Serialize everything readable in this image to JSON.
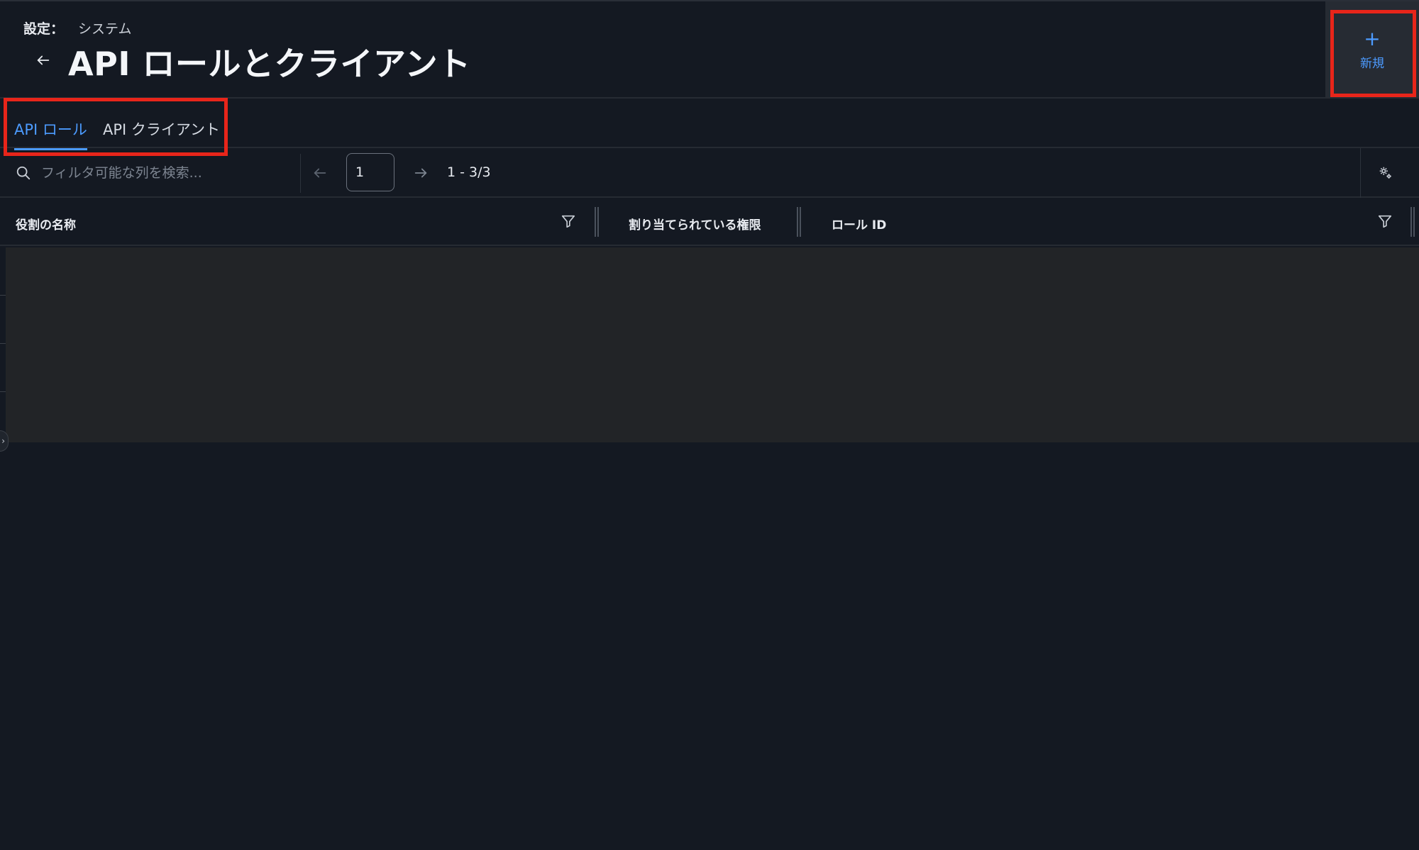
{
  "header": {
    "breadcrumb_label": "設定：",
    "breadcrumb_value": "システム",
    "title": "API ロールとクライアント",
    "new_button": {
      "icon": "plus-icon",
      "plus": "+",
      "label": "新規"
    }
  },
  "tabs": [
    {
      "label": "API ロール",
      "active": true
    },
    {
      "label": "API クライアント",
      "active": false
    }
  ],
  "toolbar": {
    "search_placeholder": "フィルタ可能な列を検索...",
    "page_value": "1",
    "range_text": "1 - 3/3"
  },
  "table": {
    "columns": [
      {
        "label": "役割の名称",
        "filterable": true
      },
      {
        "label": "割り当てられている権限",
        "filterable": false
      },
      {
        "label": "ロール ID",
        "filterable": true
      }
    ]
  },
  "colors": {
    "background": "#141922",
    "accent": "#4c9bff",
    "highlight": "#e8251a",
    "table_body": "#222427"
  }
}
